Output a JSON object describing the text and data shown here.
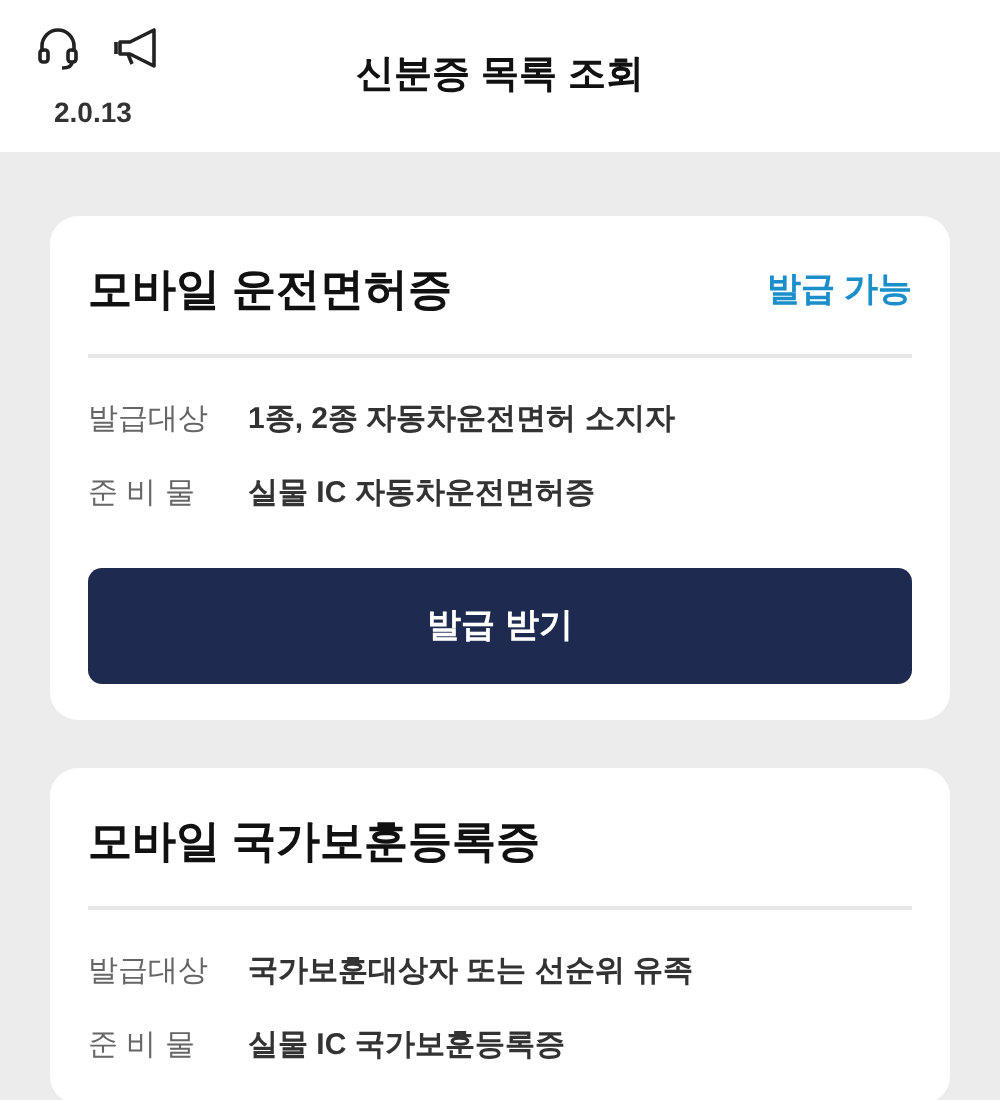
{
  "header": {
    "version": "2.0.13",
    "title": "신분증 목록 조회"
  },
  "cards": [
    {
      "title": "모바일 운전면허증",
      "status": "발급 가능",
      "rows": [
        {
          "label": "발급대상",
          "value": "1종, 2종 자동차운전면허 소지자"
        },
        {
          "label": "준 비 물",
          "value": "실물 IC 자동차운전면허증"
        }
      ],
      "button": "발급 받기"
    },
    {
      "title": "모바일 국가보훈등록증",
      "rows": [
        {
          "label": "발급대상",
          "value": "국가보훈대상자 또는 선순위 유족"
        },
        {
          "label": "준 비 물",
          "value": "실물 IC 국가보훈등록증"
        }
      ]
    }
  ]
}
